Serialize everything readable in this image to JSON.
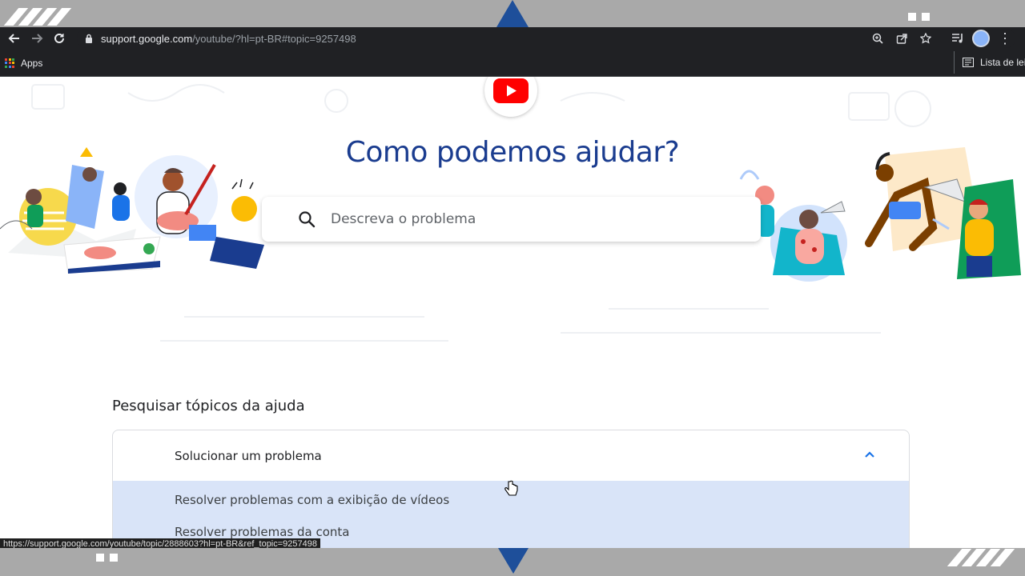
{
  "browser": {
    "url_host": "support.google.com",
    "url_path": "/youtube/?hl=pt-BR#topic=9257498",
    "bookmarks": {
      "apps_label": "Apps",
      "reading_list_label": "Lista de leitura"
    },
    "status_url": "https://support.google.com/youtube/topic/2888603?hl=pt-BR&ref_topic=9257498"
  },
  "page": {
    "hero_title": "Como podemos ajudar?",
    "search_placeholder": "Descreva o problema",
    "section_title": "Pesquisar tópicos da ajuda",
    "accordion": {
      "header": "Solucionar um problema",
      "items": [
        "Resolver problemas com a exibição de vídeos",
        "Resolver problemas da conta"
      ]
    }
  },
  "colors": {
    "accent": "#1a3c8f",
    "highlight": "#d9e4f8",
    "youtube_red": "#ff0000",
    "frame_blue": "#1e4f9a"
  }
}
